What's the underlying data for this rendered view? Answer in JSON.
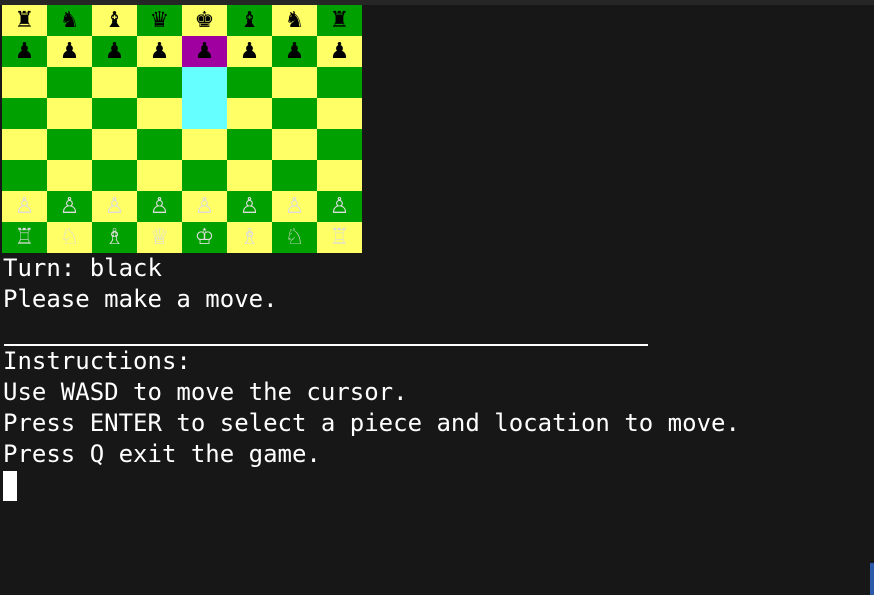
{
  "board": {
    "colors": {
      "light": "#ffff66",
      "dark": "#00a000",
      "selected": "#a000a0",
      "cursor": "#66ffff",
      "black_piece": "#000000",
      "white_piece": "#dcdcdc"
    },
    "rows": [
      [
        {
          "piece": "♜",
          "color": "black",
          "name": "black-rook"
        },
        {
          "piece": "♞",
          "color": "black",
          "name": "black-knight"
        },
        {
          "piece": "♝",
          "color": "black",
          "name": "black-bishop"
        },
        {
          "piece": "♛",
          "color": "black",
          "name": "black-queen"
        },
        {
          "piece": "♚",
          "color": "black",
          "name": "black-king"
        },
        {
          "piece": "♝",
          "color": "black",
          "name": "black-bishop"
        },
        {
          "piece": "♞",
          "color": "black",
          "name": "black-knight"
        },
        {
          "piece": "♜",
          "color": "black",
          "name": "black-rook"
        }
      ],
      [
        {
          "piece": "♟",
          "color": "black",
          "name": "black-pawn"
        },
        {
          "piece": "♟",
          "color": "black",
          "name": "black-pawn"
        },
        {
          "piece": "♟",
          "color": "black",
          "name": "black-pawn"
        },
        {
          "piece": "♟",
          "color": "black",
          "name": "black-pawn"
        },
        {
          "piece": "♟",
          "color": "black",
          "name": "black-pawn",
          "state": "selected"
        },
        {
          "piece": "♟",
          "color": "black",
          "name": "black-pawn"
        },
        {
          "piece": "♟",
          "color": "black",
          "name": "black-pawn"
        },
        {
          "piece": "♟",
          "color": "black",
          "name": "black-pawn"
        }
      ],
      [
        {
          "piece": ""
        },
        {
          "piece": ""
        },
        {
          "piece": ""
        },
        {
          "piece": ""
        },
        {
          "piece": "",
          "state": "cursor"
        },
        {
          "piece": ""
        },
        {
          "piece": ""
        },
        {
          "piece": ""
        }
      ],
      [
        {
          "piece": ""
        },
        {
          "piece": ""
        },
        {
          "piece": ""
        },
        {
          "piece": ""
        },
        {
          "piece": "",
          "state": "cursor"
        },
        {
          "piece": ""
        },
        {
          "piece": ""
        },
        {
          "piece": ""
        }
      ],
      [
        {
          "piece": ""
        },
        {
          "piece": ""
        },
        {
          "piece": ""
        },
        {
          "piece": ""
        },
        {
          "piece": ""
        },
        {
          "piece": ""
        },
        {
          "piece": ""
        },
        {
          "piece": ""
        }
      ],
      [
        {
          "piece": ""
        },
        {
          "piece": ""
        },
        {
          "piece": ""
        },
        {
          "piece": ""
        },
        {
          "piece": ""
        },
        {
          "piece": ""
        },
        {
          "piece": ""
        },
        {
          "piece": ""
        }
      ],
      [
        {
          "piece": "♙",
          "color": "white",
          "name": "white-pawn"
        },
        {
          "piece": "♙",
          "color": "white",
          "name": "white-pawn"
        },
        {
          "piece": "♙",
          "color": "white",
          "name": "white-pawn"
        },
        {
          "piece": "♙",
          "color": "white",
          "name": "white-pawn"
        },
        {
          "piece": "♙",
          "color": "white",
          "name": "white-pawn"
        },
        {
          "piece": "♙",
          "color": "white",
          "name": "white-pawn"
        },
        {
          "piece": "♙",
          "color": "white",
          "name": "white-pawn"
        },
        {
          "piece": "♙",
          "color": "white",
          "name": "white-pawn"
        }
      ],
      [
        {
          "piece": "♖",
          "color": "white",
          "name": "white-rook"
        },
        {
          "piece": "♘",
          "color": "white",
          "name": "white-knight"
        },
        {
          "piece": "♗",
          "color": "white",
          "name": "white-bishop"
        },
        {
          "piece": "♕",
          "color": "white",
          "name": "white-queen"
        },
        {
          "piece": "♔",
          "color": "white",
          "name": "white-king"
        },
        {
          "piece": "♗",
          "color": "white",
          "name": "white-bishop"
        },
        {
          "piece": "♘",
          "color": "white",
          "name": "white-knight"
        },
        {
          "piece": "♖",
          "color": "white",
          "name": "white-rook"
        }
      ]
    ]
  },
  "status": {
    "turn": "Turn: black",
    "prompt": "Please make a move."
  },
  "instructions": {
    "heading": "Instructions:",
    "lines": [
      "Use WASD to move the cursor.",
      "Press ENTER to select a piece and location to move.",
      "Press Q exit the game."
    ]
  }
}
